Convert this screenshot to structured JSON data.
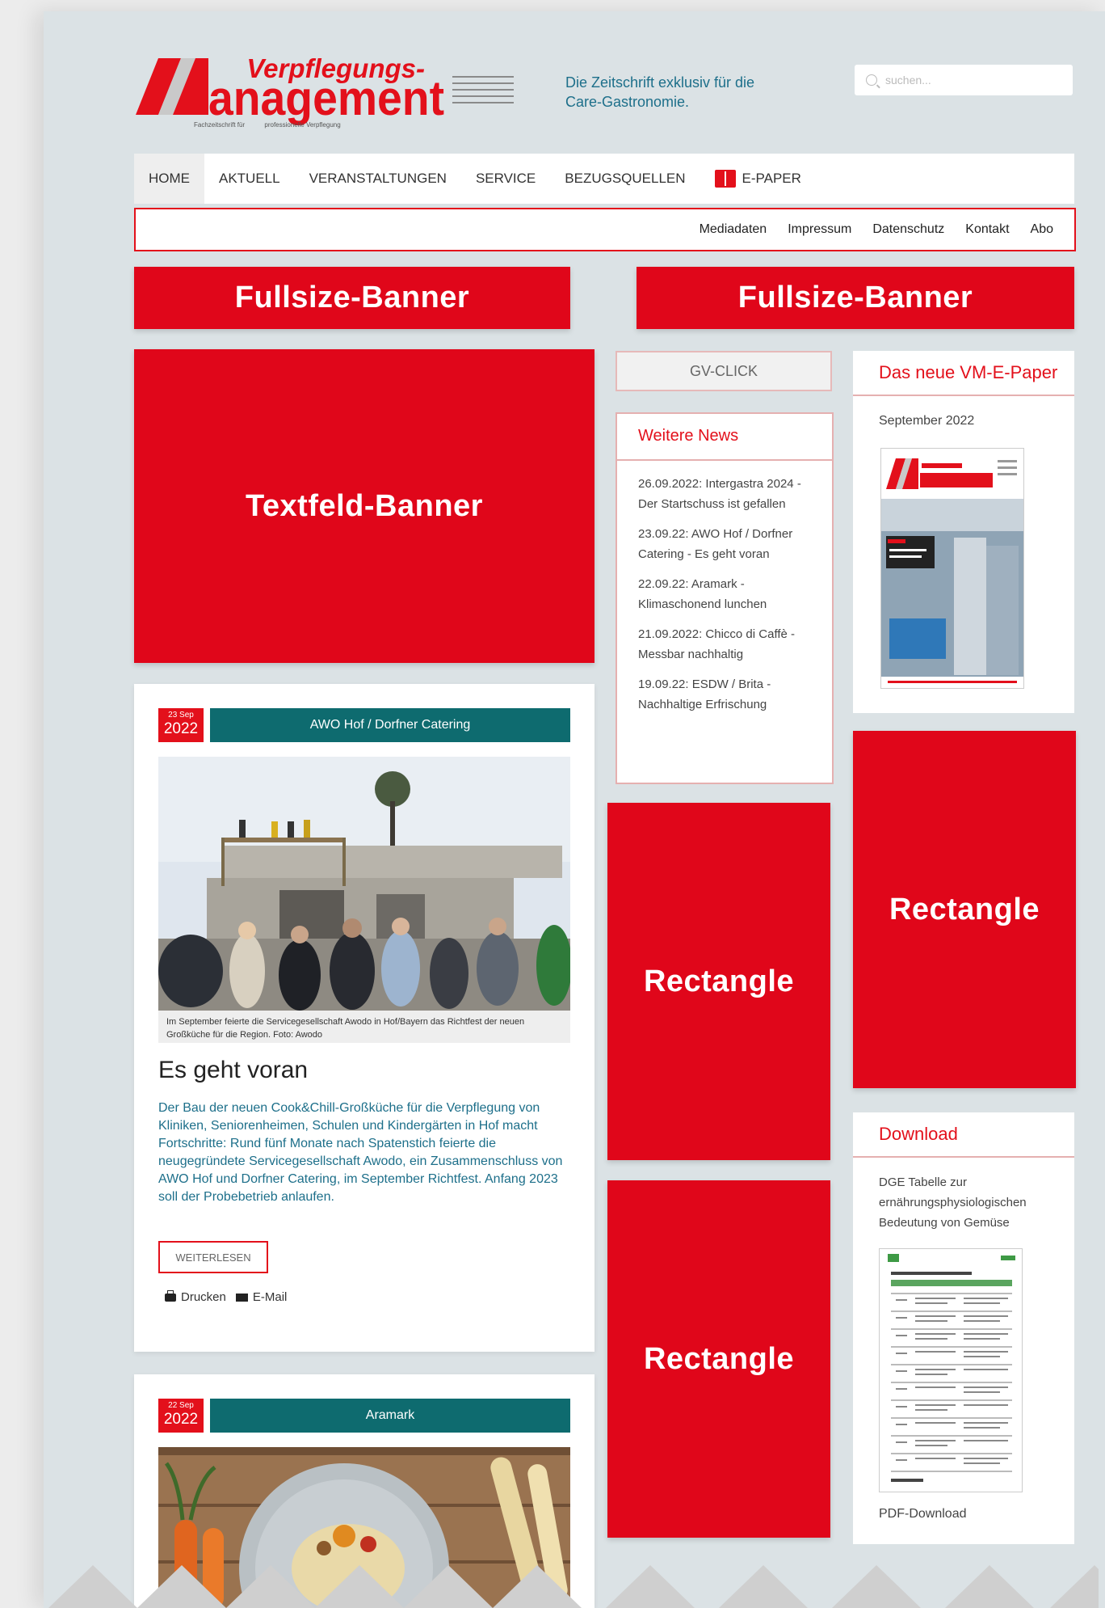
{
  "logo": {
    "top": "Verpflegungs-",
    "main": "Management",
    "sub_left": "Fachzeitschrift für",
    "sub_right": "professionelle Verpflegung"
  },
  "tagline": "Die Zeitschrift exklusiv für die Care-Gastronomie.",
  "search": {
    "placeholder": "suchen..."
  },
  "nav": {
    "items": [
      "HOME",
      "AKTUELL",
      "VERANSTALTUNGEN",
      "SERVICE",
      "BEZUGSQUELLEN",
      "E-PAPER"
    ]
  },
  "subnav": {
    "items": [
      "Mediadaten",
      "Impressum",
      "Datenschutz",
      "Kontakt",
      "Abo"
    ]
  },
  "banners": {
    "fullsize_1": "Fullsize-Banner",
    "fullsize_2": "Fullsize-Banner",
    "textfeld": "Textfeld-Banner",
    "rectangle_1": "Rectangle",
    "rectangle_2": "Rectangle",
    "rectangle_3": "Rectangle"
  },
  "article1": {
    "date_day": "23 Sep",
    "date_year": "2022",
    "category": "AWO Hof / Dorfner Catering",
    "caption": "Im September feierte die Servicegesellschaft Awodo in Hof/Bayern das Richtfest der neuen Großküche für die Region. Foto: Awodo",
    "headline": "Es geht voran",
    "teaser": "Der Bau der neuen Cook&Chill-Großküche für die Verpflegung von Kliniken, Seniorenheimen, Schulen und Kindergärten in Hof macht Fortschritte: Rund fünf Monate nach Spatenstich feierte die neugegründete Servicegesellschaft Awodo, ein Zusammenschluss von AWO Hof und Dorfner Catering, im September Richtfest. Anfang 2023 soll der Probebetrieb anlaufen.",
    "more_label": "WEITERLESEN",
    "print_label": "Drucken",
    "email_label": "E-Mail"
  },
  "article2": {
    "date_day": "22 Sep",
    "date_year": "2022",
    "category": "Aramark"
  },
  "gvclick": {
    "label": "GV-CLICK"
  },
  "news": {
    "title": "Weitere News",
    "items": [
      "26.09.2022: Intergastra 2024 - Der Startschuss ist gefallen",
      "23.09.22: AWO Hof / Dorfner Catering - Es geht voran",
      "22.09.22: Aramark - Klimaschonend lunchen",
      "21.09.2022: Chicco di Caffè - Messbar nachhaltig",
      "19.09.22: ESDW / Brita - Nachhaltige Erfrischung"
    ]
  },
  "epaper": {
    "title": "Das neue VM-E-Paper",
    "issue": "September 2022"
  },
  "download": {
    "title": "Download",
    "description": "DGE Tabelle zur ernährungsphysiologischen Bedeutung von Gemüse",
    "link": "PDF-Download"
  },
  "colors": {
    "brand_red": "#e3101b",
    "banner_red": "#e0061a",
    "category_teal": "#0e6b6f",
    "link_blue": "#1d6f8a",
    "page_bg": "#dbe2e5"
  }
}
